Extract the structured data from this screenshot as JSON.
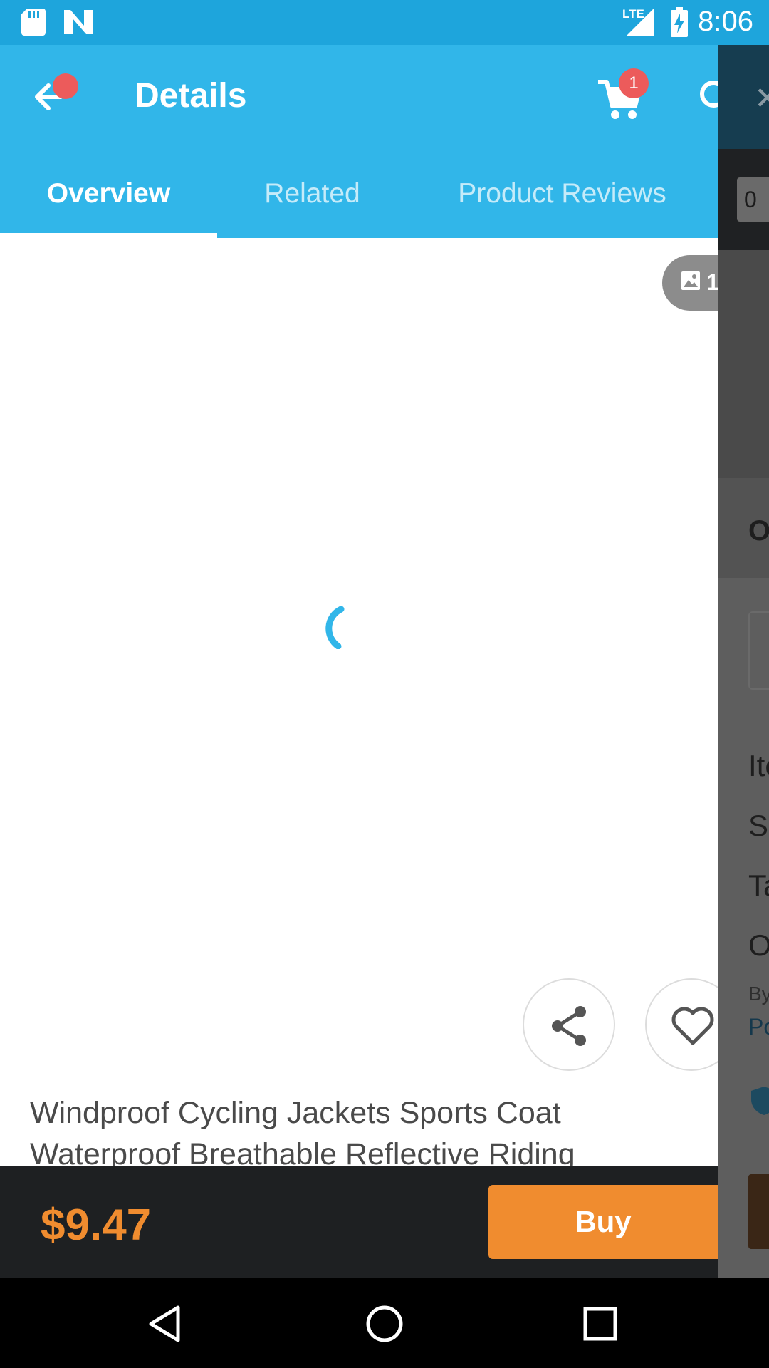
{
  "status_bar": {
    "time": "8:06",
    "network": "LTE",
    "icons": [
      "sd-card-icon",
      "n-icon",
      "signal-icon",
      "battery-charging-icon"
    ]
  },
  "app_bar": {
    "title": "Details",
    "cart_count": "1",
    "icons": [
      "back-arrow-icon",
      "cart-icon",
      "search-icon"
    ]
  },
  "tabs": [
    {
      "label": "Overview",
      "active": true
    },
    {
      "label": "Related",
      "active": false
    },
    {
      "label": "Product Reviews",
      "active": false
    }
  ],
  "gallery": {
    "photo_count": "1",
    "loading": true
  },
  "actions": {
    "share_icon": "share-icon",
    "favorite_icon": "heart-icon"
  },
  "product": {
    "title_line1": "Windproof Cycling Jackets Sports Coat",
    "title_line2": "Waterproof Breathable Reflective Riding"
  },
  "bottom_bar": {
    "price": "$9.47",
    "buy_label": "Buy"
  },
  "side_panel": {
    "qty_value": "0",
    "heading": "O",
    "lines": [
      "Ite",
      "S",
      "Ta",
      "O"
    ],
    "by_label": "By",
    "link_text": "Po"
  },
  "colors": {
    "status_bar": "#1ea5dc",
    "app_bar": "#31b6e9",
    "accent_orange": "#f08c2f",
    "badge_red": "#ec5b5b",
    "bottom_bar": "#1e2022"
  }
}
